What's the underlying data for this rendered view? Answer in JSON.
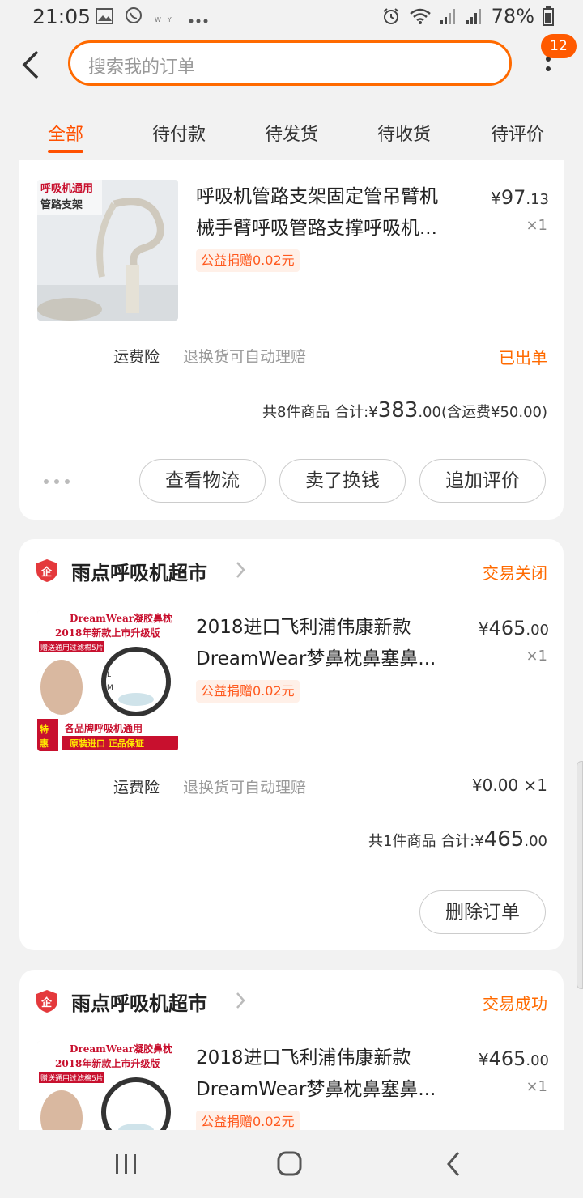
{
  "status_bar": {
    "time": "21:05",
    "notification_icons": [
      "image-icon",
      "whatsapp-icon",
      "wyze-icon",
      "more-dots-icon"
    ],
    "battery": "78%"
  },
  "search": {
    "placeholder": "搜索我的订单"
  },
  "badge_count": "12",
  "tabs": [
    {
      "label": "全部",
      "active": true
    },
    {
      "label": "待付款",
      "active": false
    },
    {
      "label": "待发货",
      "active": false
    },
    {
      "label": "待收货",
      "active": false
    },
    {
      "label": "待评价",
      "active": false
    }
  ],
  "orders": [
    {
      "item": {
        "title": "呼吸机管路支架固定管吊臂机械手臂呼吸管路支撑呼吸机...",
        "thumb_text": [
          "呼吸机通用",
          "管路支架"
        ],
        "donate": "公益捐赠0.02元",
        "price_symbol": "¥",
        "price_int": "97",
        "price_dec": ".13",
        "qty": "×1"
      },
      "insurance": {
        "label": "运费险",
        "desc": "退换货可自动理赔",
        "right": "已出单"
      },
      "summary": {
        "count_text": "共8件商品",
        "total_label": "合计:",
        "symbol": "¥",
        "total_int": "383",
        "total_dec": ".00",
        "shipping": "(含运费¥50.00)"
      },
      "buttons": [
        "查看物流",
        "卖了换钱",
        "追加评价"
      ]
    },
    {
      "shop": "雨点呼吸机超市",
      "status": "交易关闭",
      "item": {
        "title": "2018进口飞利浦伟康新款DreamWear梦鼻枕鼻塞鼻...",
        "thumb_lines": [
          "DreamWear凝胶鼻枕",
          "2018年新款上市升级版",
          "赠送通用过滤棉5片",
          "各品牌呼吸机通用",
          "原装进口 正品保证"
        ],
        "donate": "公益捐赠0.02元",
        "price_symbol": "¥",
        "price_int": "465",
        "price_dec": ".00",
        "qty": "×1"
      },
      "insurance": {
        "label": "运费险",
        "desc": "退换货可自动理赔",
        "right": "¥0.00 ×1"
      },
      "summary": {
        "count_text": "共1件商品",
        "total_label": "合计:",
        "symbol": "¥",
        "total_int": "465",
        "total_dec": ".00"
      },
      "buttons": [
        "删除订单"
      ]
    },
    {
      "shop": "雨点呼吸机超市",
      "status": "交易成功",
      "item": {
        "title": "2018进口飞利浦伟康新款DreamWear梦鼻枕鼻塞鼻...",
        "thumb_lines": [
          "DreamWear凝胶鼻枕",
          "2018年新款上市升级版",
          "赠送通用过滤棉5片"
        ],
        "donate": "公益捐赠0.02元",
        "price_symbol": "¥",
        "price_int": "465",
        "price_dec": ".00",
        "qty": "×1"
      }
    }
  ],
  "colors": {
    "accent": "#ff6a00",
    "tab_active": "#ff5000",
    "donate_bg": "#fff0e8"
  }
}
